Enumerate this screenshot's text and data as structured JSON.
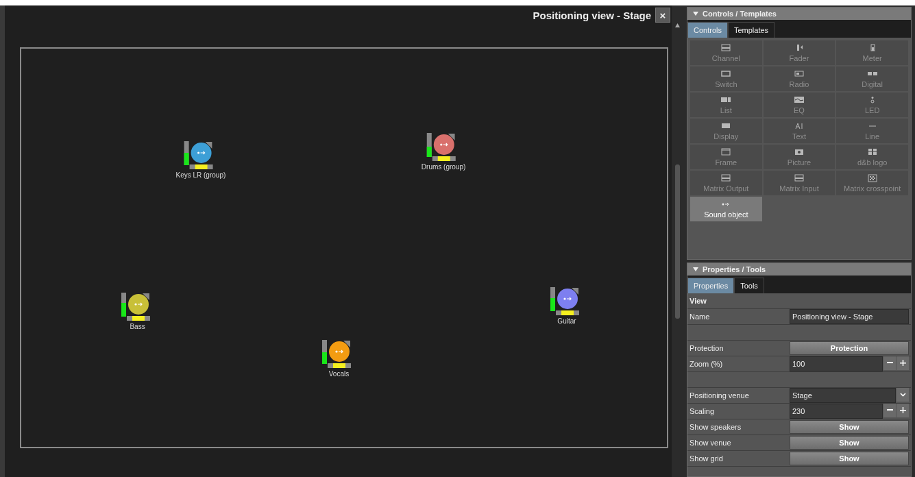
{
  "view": {
    "title": "Positioning view - Stage",
    "close": "×",
    "objects": [
      {
        "label": "Keys LR (group)",
        "color": "#3d9fd6",
        "level": 0.5
      },
      {
        "label": "Drums (group)",
        "color": "#d9706c",
        "level": 0.45
      },
      {
        "label": "Bass",
        "color": "#c8c038",
        "level": 0.55
      },
      {
        "label": "Guitar",
        "color": "#7d7ff0",
        "level": 0.55
      },
      {
        "label": "Vocals",
        "color": "#f39c12",
        "level": 0.5
      }
    ]
  },
  "controls_panel": {
    "title": "Controls / Templates",
    "tabs": [
      {
        "label": "Controls",
        "selected": true
      },
      {
        "label": "Templates",
        "selected": false
      }
    ],
    "items": [
      {
        "label": "Channel",
        "kind": "channel",
        "selected": false
      },
      {
        "label": "Fader",
        "kind": "fader",
        "selected": false
      },
      {
        "label": "Meter",
        "kind": "meter",
        "selected": false
      },
      {
        "label": "Switch",
        "kind": "switch",
        "selected": false
      },
      {
        "label": "Radio",
        "kind": "radio",
        "selected": false
      },
      {
        "label": "Digital",
        "kind": "digital",
        "selected": false
      },
      {
        "label": "List",
        "kind": "list",
        "selected": false
      },
      {
        "label": "EQ",
        "kind": "eq",
        "selected": false
      },
      {
        "label": "LED",
        "kind": "led",
        "selected": false
      },
      {
        "label": "Display",
        "kind": "display",
        "selected": false
      },
      {
        "label": "Text",
        "kind": "text",
        "selected": false
      },
      {
        "label": "Line",
        "kind": "line",
        "selected": false
      },
      {
        "label": "Frame",
        "kind": "frame",
        "selected": false
      },
      {
        "label": "Picture",
        "kind": "picture",
        "selected": false
      },
      {
        "label": "d&b logo",
        "kind": "logo",
        "selected": false
      },
      {
        "label": "Matrix Output",
        "kind": "channel",
        "selected": false
      },
      {
        "label": "Matrix Input",
        "kind": "channel",
        "selected": false
      },
      {
        "label": "Matrix crosspoint",
        "kind": "crosspoint",
        "selected": false
      },
      {
        "label": "Sound object",
        "kind": "object",
        "selected": true
      }
    ]
  },
  "properties_panel": {
    "title": "Properties / Tools",
    "tabs": [
      {
        "label": "Properties",
        "selected": true
      },
      {
        "label": "Tools",
        "selected": false
      }
    ],
    "rows": [
      {
        "kind": "section",
        "label": "View"
      },
      {
        "kind": "text",
        "label": "Name",
        "value": "Positioning view - Stage"
      },
      {
        "kind": "spacer"
      },
      {
        "kind": "button",
        "label": "Protection",
        "value": "Protection"
      },
      {
        "kind": "number",
        "label": "Zoom (%)",
        "value": "100"
      },
      {
        "kind": "spacer"
      },
      {
        "kind": "select",
        "label": "Positioning venue",
        "value": "Stage"
      },
      {
        "kind": "number",
        "label": "Scaling",
        "value": "230"
      },
      {
        "kind": "button",
        "label": "Show speakers",
        "value": "Show"
      },
      {
        "kind": "button",
        "label": "Show venue",
        "value": "Show"
      },
      {
        "kind": "button",
        "label": "Show grid",
        "value": "Show"
      }
    ]
  }
}
